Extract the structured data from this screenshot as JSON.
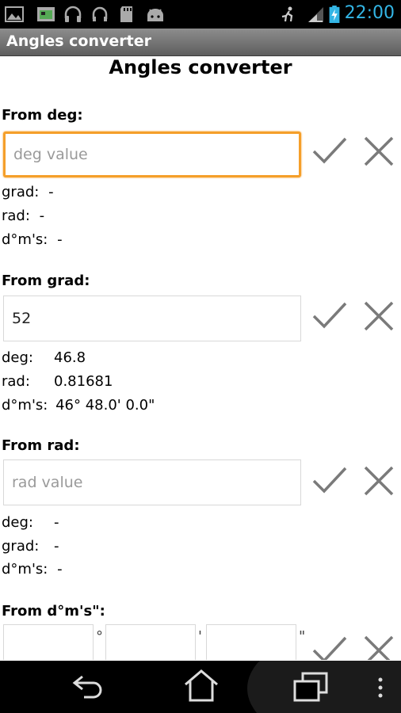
{
  "status_bar": {
    "time": "22:00",
    "left_icons": [
      "image-icon",
      "media-icon",
      "headphones-icon",
      "headset-icon",
      "sd-card-icon",
      "android-debug-icon"
    ],
    "right_icons": [
      "sync-icon",
      "signal-icon",
      "battery-charging-icon"
    ]
  },
  "app_bar": {
    "title": "Angles converter"
  },
  "page": {
    "title": "Angles converter"
  },
  "from_deg": {
    "label": "From deg:",
    "placeholder": "deg value",
    "value": "",
    "results": [
      {
        "label": "grad:",
        "value": "-"
      },
      {
        "label": "rad:",
        "value": "-"
      },
      {
        "label": "d°m's:",
        "value": "-"
      }
    ]
  },
  "from_grad": {
    "label": "From grad:",
    "placeholder": "",
    "value": "52",
    "results": [
      {
        "label": "deg:",
        "value": "46.8"
      },
      {
        "label": "rad:",
        "value": "0.81681"
      },
      {
        "label": "d°m's:",
        "value": "46° 48.0' 0.0\""
      }
    ]
  },
  "from_rad": {
    "label": "From rad:",
    "placeholder": "rad value",
    "value": "",
    "results": [
      {
        "label": "deg:",
        "value": "-"
      },
      {
        "label": "grad:",
        "value": "-"
      },
      {
        "label": "d°m's:",
        "value": "-"
      }
    ]
  },
  "from_dms": {
    "label": "From d°m's\":",
    "sep_deg": "°",
    "sep_min": "'",
    "sep_sec": "\""
  },
  "colors": {
    "focus": "#f59f2a",
    "clock": "#33b5e5",
    "icon_gray": "#7a7a7a"
  },
  "nav_bar": {
    "buttons": [
      "back-icon",
      "home-icon",
      "recent-apps-icon",
      "menu-icon"
    ]
  }
}
